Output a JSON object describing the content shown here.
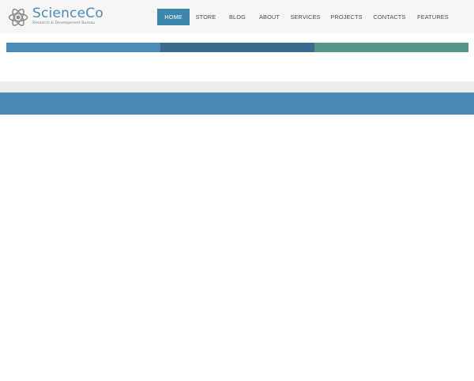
{
  "brand": {
    "name": "ScienceCo",
    "tagline": "Research & Development Bureau",
    "icon": "atom-icon"
  },
  "nav": {
    "items": [
      {
        "label": "HOME",
        "active": true
      },
      {
        "label": "STORE",
        "active": false
      },
      {
        "label": "BLOG",
        "active": false
      },
      {
        "label": "ABOUT",
        "active": false
      },
      {
        "label": "SERVICES",
        "active": false
      },
      {
        "label": "PROJECTS",
        "active": false
      },
      {
        "label": "CONTACTS",
        "active": false
      },
      {
        "label": "FEATURES",
        "active": false
      }
    ]
  },
  "colors": {
    "brand_blue": "#4a8bb8",
    "nav_active": "#3d86ad",
    "strip": [
      "#4a8bb8",
      "#3b6a8e",
      "#56958c"
    ],
    "band_blue": "#4a8ab6",
    "band_gray": "#eeeeee"
  }
}
